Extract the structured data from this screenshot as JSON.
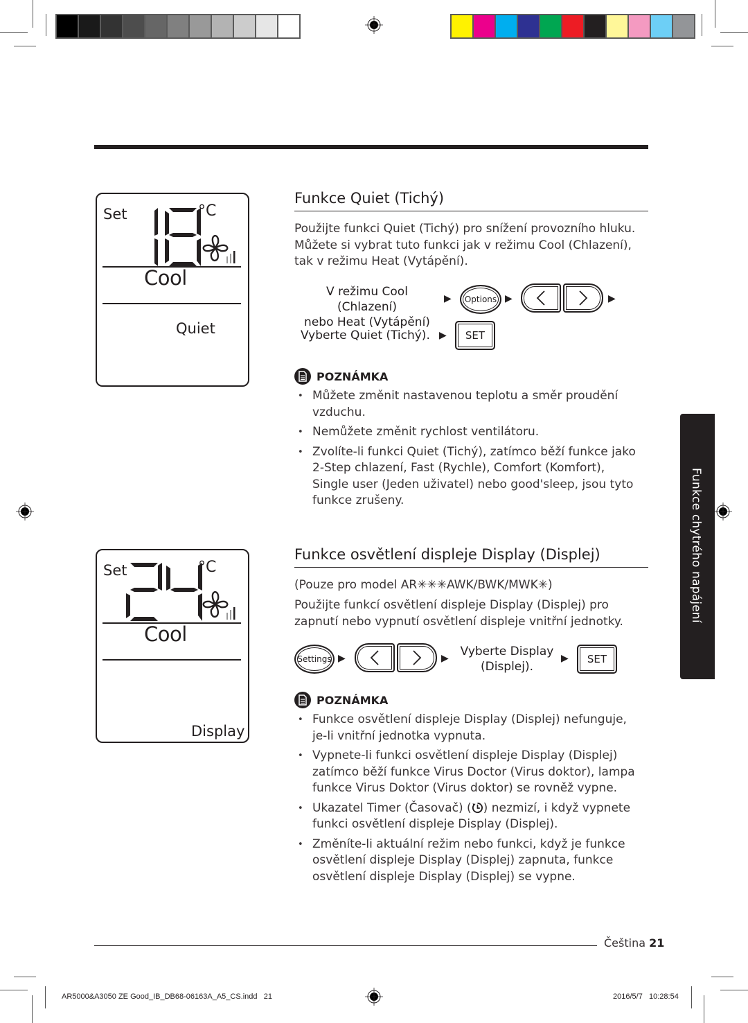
{
  "print_marks": {
    "grayscale_swatches": [
      "#000000",
      "#1a1a1a",
      "#333333",
      "#4d4d4d",
      "#666666",
      "#808080",
      "#999999",
      "#b3b3b3",
      "#cccccc",
      "#e6e6e6",
      "#ffffff"
    ],
    "color_swatches": [
      "#fff200",
      "#ec008c",
      "#00aeef",
      "#2e3192",
      "#00a651",
      "#ed1c24",
      "#231f20",
      "#fff799",
      "#f49ac1",
      "#6dcff6",
      "#939598"
    ]
  },
  "sidetab": {
    "label": "Funkce chytrého napájení"
  },
  "quiet": {
    "lcd": {
      "set": "Set",
      "temp": "18",
      "unit": "°C",
      "mode": "Cool",
      "function": "Quiet"
    },
    "heading": "Funkce Quiet (Tichý)",
    "intro": "Použijte funkci Quiet (Tichý) pro snížení provozního hluku. Můžete si vybrat tuto funkci jak v režimu Cool (Chlazení), tak v režimu Heat (Vytápění).",
    "steps": {
      "line1a": "V režimu Cool (Chlazení)",
      "line1b": "nebo Heat (Vytápění)",
      "options_button": "Options",
      "select_label": "Vyberte Quiet (Tichý).",
      "set_button": "SET",
      "arrow": "▶"
    },
    "note": {
      "title": "POZNÁMKA",
      "items": [
        "Můžete změnit nastavenou teplotu a směr proudění vzduchu.",
        "Nemůžete změnit rychlost ventilátoru.",
        "Zvolíte-li funkci Quiet (Tichý), zatímco běží funkce jako 2-Step chlazení, Fast (Rychle), Comfort (Komfort), Single user (Jeden uživatel) nebo good'sleep, jsou tyto funkce zrušeny."
      ]
    }
  },
  "display": {
    "lcd": {
      "set": "Set",
      "temp": "24",
      "unit": "°C",
      "mode": "Cool",
      "function": "Display"
    },
    "heading": "Funkce osvětlení displeje Display (Displej)",
    "model_note": "(Pouze pro model AR✳✳✳AWK/BWK/MWK✳)",
    "intro": "Použijte funkcí osvětlení displeje Display (Displej) pro zapnutí nebo vypnutí osvětlení displeje vnitřní jednotky.",
    "steps": {
      "settings_button": "Settings",
      "select_a": "Vyberte Display",
      "select_b": "(Displej).",
      "set_button": "SET",
      "arrow": "▶"
    },
    "note": {
      "title": "POZNÁMKA",
      "items": [
        "Funkce osvětlení displeje Display (Displej) nefunguje, je-li vnitřní jednotka vypnuta.",
        "Vypnete-li funkci osvětlení displeje Display (Displej) zatímco běží funkce Virus Doctor (Virus doktor), lampa funkce Virus Doktor (Virus doktor) se rovněž vypne.",
        "Změníte-li aktuální režim nebo funkci, když je funkce osvětlení displeje Display (Displej) zapnuta, funkce osvětlení displeje Display (Displej) se vypne."
      ],
      "timer_item_a": "Ukazatel Timer (Časovač) (",
      "timer_item_b": ") nezmizí, i když vypnete funkci osvětlení displeje Display (Displej)."
    }
  },
  "footer": {
    "language": "Čeština",
    "page": "21",
    "slug_file": "AR5000&A3050 ZE Good_IB_DB68-06163A_A5_CS.indd   21",
    "slug_date": "2016/5/7   10:28:54"
  }
}
